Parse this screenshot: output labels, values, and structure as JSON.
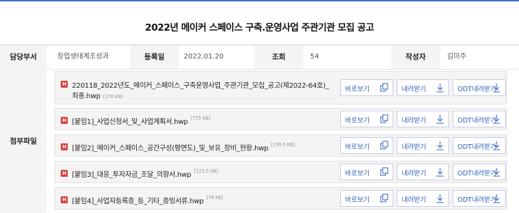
{
  "title": "2022년 메이커 스페이스 구축.운영사업 주관기관 모집 공고",
  "info": {
    "dept_label": "담당부서",
    "dept_value": "창업생태계조성과",
    "date_label": "등록일",
    "date_value": "2022.01.20",
    "views_label": "조회",
    "views_value": "54",
    "author_label": "작성자",
    "author_value": "김미주"
  },
  "attachments": {
    "label": "첨부파일",
    "icon_text": "H",
    "buttons": {
      "view": "바로보기",
      "download": "내려받기",
      "odt": "ODT내려받기"
    },
    "files": [
      {
        "line1": "220118_2022년도_메이커_스페이스_구축운영사업_주관기관_모집_공고(제2022-64호)_",
        "line2": "최종.hwp",
        "size": "[176 KB]"
      },
      {
        "line1": "[붙임1]_사업신청서_및_사업계획서.hwp",
        "line2": "",
        "size": "[775 KB]"
      },
      {
        "line1": "[붙임2]_메이커_스페이스_공간구성(평면도)_및_보유_장비_현황.hwp",
        "line2": "",
        "size": "[199.5 KB]"
      },
      {
        "line1": "[붙임3]_대응_투자자금_조달_의향서.hwp",
        "line2": "",
        "size": "[123.5 KB]"
      },
      {
        "line1": "[붙임4]_사업자등록증_등_기타_증빙서류.hwp",
        "line2": "",
        "size": "[76 KB]"
      }
    ]
  },
  "colors": {
    "accent": "#3a6fc0",
    "button_text": "#2f61b8",
    "file_icon": "#d9413a"
  }
}
